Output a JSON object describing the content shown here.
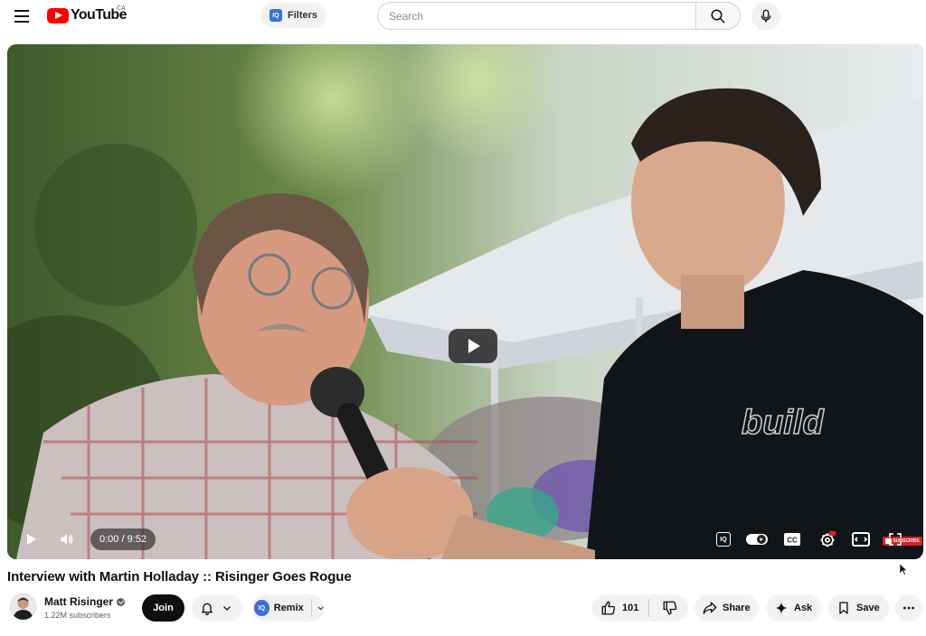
{
  "header": {
    "logo_text": "YouTube",
    "region": "CA",
    "filters_label": "Filters",
    "filters_badge": "IQ",
    "search_placeholder": "Search"
  },
  "player": {
    "time": "0:00 / 9:52",
    "progress": 0.0,
    "watermark": "SUBSCRIBE",
    "shirt_logo": "build",
    "iq_badge": "IQ"
  },
  "video": {
    "title": "Interview with Martin Holladay :: Risinger Goes Rogue"
  },
  "channel": {
    "name": "Matt Risinger",
    "subscribers": "1.22M subscribers",
    "join_label": "Join",
    "remix_label": "Remix",
    "remix_badge": "IQ"
  },
  "actions": {
    "likes": "101",
    "share_label": "Share",
    "ask_label": "Ask",
    "save_label": "Save"
  },
  "colors": {
    "brand_red": "#ff0000",
    "iq_blue": "#3d6fdc",
    "pill_bg": "#f2f2f2"
  }
}
